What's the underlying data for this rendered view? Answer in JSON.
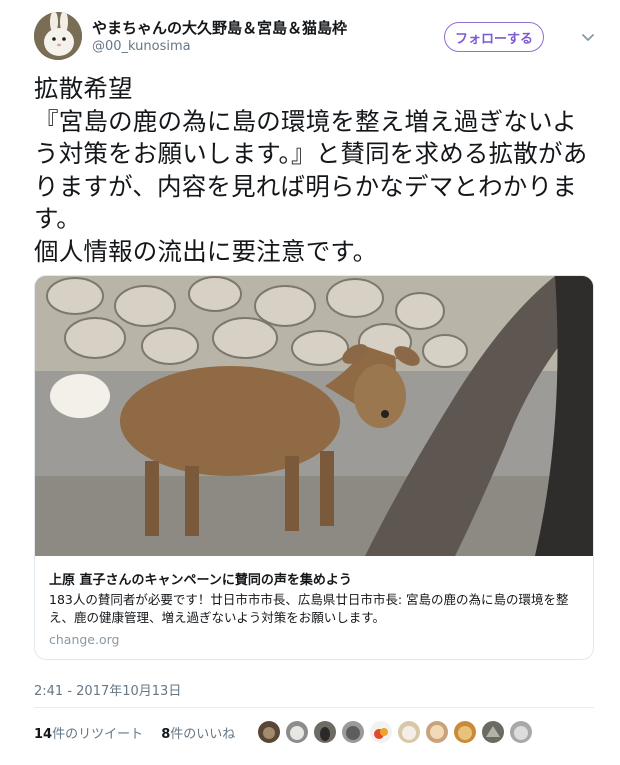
{
  "user": {
    "name": "やまちゃんの大久野島＆宮島＆猫島枠",
    "handle": "@00_kunosima",
    "follow_label": "フォローする"
  },
  "tweet": {
    "text": "拡散希望\n『宮島の鹿の為に島の環境を整え増え過ぎないよう対策をお願いします。』と賛同を求める拡散がありますが、内容を見れば明らかなデマとわかります。\n個人情報の流出に要注意です。"
  },
  "card": {
    "title": "上原 直子さんのキャンペーンに賛同の声を集めよう",
    "description": "183人の賛同者が必要です！廿日市市市長、広島県廿日市市長: 宮島の鹿の為に島の環境を整え、鹿の健康管理、増え過ぎないよう対策をお願いします。",
    "domain": "change.org"
  },
  "timestamp": "2:41 - 2017年10月13日",
  "stats": {
    "retweets_count": "14",
    "retweets_label": "件のリツイート",
    "likes_count": "8",
    "likes_label": "件のいいね"
  },
  "colors": {
    "follow_accent": "#7c5bd0",
    "text_primary": "#14171a",
    "text_secondary": "#657786"
  },
  "icons": [
    "rabbit-avatar-icon",
    "chevron-down-icon"
  ]
}
